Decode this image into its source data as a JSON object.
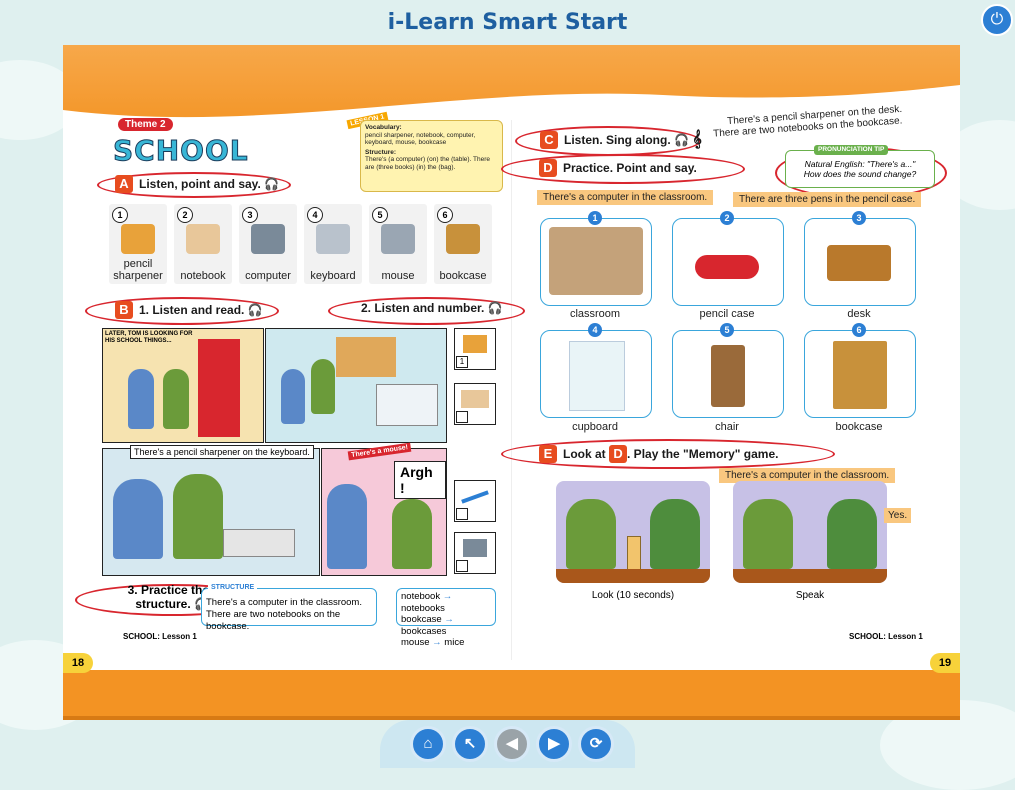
{
  "app": {
    "title": "i-Learn Smart Start"
  },
  "theme": {
    "badge": "Theme 2",
    "title": "SCHOOL",
    "lesson_tag": "LESSON 1"
  },
  "vocab_box": {
    "vocab_heading": "Vocabulary:",
    "vocab_text": "pencil sharpener, notebook, computer, keyboard, mouse, bookcase",
    "structure_heading": "Structure:",
    "structure_text": "There's (a computer) (on) the (table). There are (three books) (in) the (bag)."
  },
  "section_a": {
    "letter": "A",
    "title": "Listen, point and say."
  },
  "vocab_items": [
    {
      "num": "1",
      "label": "pencil sharpener",
      "color": "#e8a23a"
    },
    {
      "num": "2",
      "label": "notebook",
      "color": "#e8c79a"
    },
    {
      "num": "3",
      "label": "computer",
      "color": "#7a8a99"
    },
    {
      "num": "4",
      "label": "keyboard",
      "color": "#b9c2cc"
    },
    {
      "num": "5",
      "label": "mouse",
      "color": "#9aa6b3"
    },
    {
      "num": "6",
      "label": "bookcase",
      "color": "#c8913b"
    }
  ],
  "section_b": {
    "letter": "B",
    "title1": "1. Listen and read.",
    "title2": "2. Listen and number."
  },
  "comic": {
    "caption1": "LATER, TOM IS LOOKING FOR HIS SCHOOL THINGS...",
    "caption2": "There's a pencil sharpener on the keyboard.",
    "shout": "Argh !",
    "shout_small": "There's a mouse!",
    "tick1": "1"
  },
  "practice": {
    "title": "3. Practice the structure.",
    "tag": "STRUCTURE",
    "line1": "There's a computer in the classroom.",
    "line2": "There are two notebooks on the bookcase."
  },
  "plurals": [
    {
      "sing": "notebook",
      "plural": "notebooks"
    },
    {
      "sing": "bookcase",
      "plural": "bookcases"
    },
    {
      "sing": "mouse",
      "plural": "mice"
    }
  ],
  "footer": {
    "left": "SCHOOL: Lesson 1",
    "right": "SCHOOL: Lesson 1",
    "page_left": "18",
    "page_right": "19"
  },
  "section_c": {
    "letter": "C",
    "title": "Listen. Sing along.",
    "lyric1": "There's a pencil sharpener on the desk.",
    "lyric2": "There are two notebooks on the bookcase."
  },
  "pronunciation": {
    "tag": "PRONUNCIATION TIP",
    "line1": "Natural English: \"There's a...\"",
    "line2": "How does the sound change?"
  },
  "section_d": {
    "letter": "D",
    "title": "Practice. Point and say.",
    "callout1": "There's a computer in the classroom.",
    "callout2": "There are three pens in the pencil case."
  },
  "photos": [
    {
      "num": "1",
      "label": "classroom"
    },
    {
      "num": "2",
      "label": "pencil case"
    },
    {
      "num": "3",
      "label": "desk"
    },
    {
      "num": "4",
      "label": "cupboard"
    },
    {
      "num": "5",
      "label": "chair"
    },
    {
      "num": "6",
      "label": "bookcase"
    }
  ],
  "section_e": {
    "letter": "E",
    "title_pre": "Look at",
    "title_ref": "D",
    "title_post": ". Play the \"Memory\" game.",
    "callout": "There's a computer in the classroom.",
    "yes": "Yes.",
    "cap1": "Look (10 seconds)",
    "cap2": "Speak"
  },
  "nav": {
    "home": "home-icon",
    "back": "back-icon",
    "prev": "prev-icon",
    "next": "next-icon",
    "refresh": "refresh-icon"
  }
}
